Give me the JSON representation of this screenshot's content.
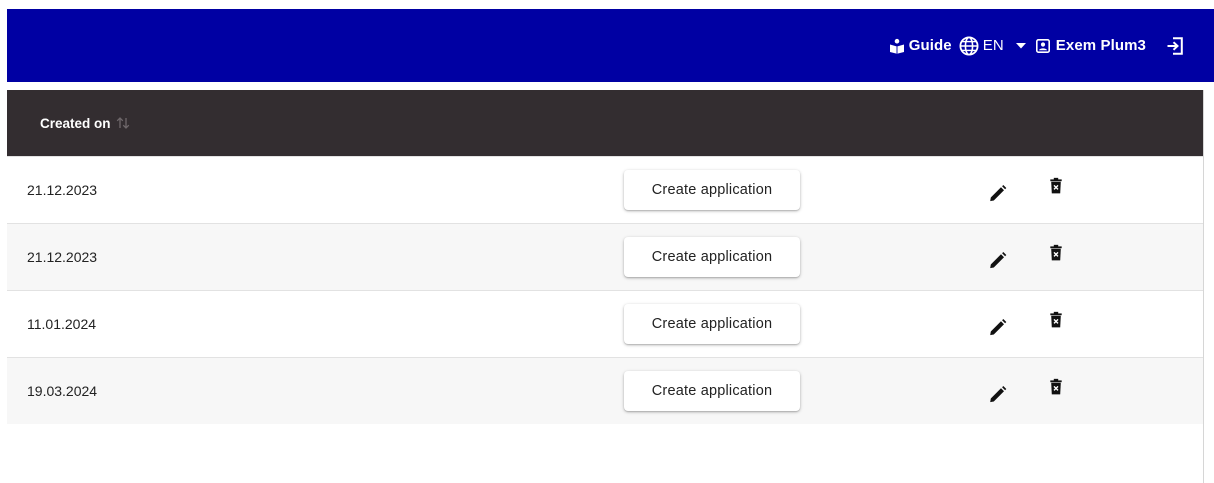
{
  "header": {
    "guide_label": "Guide",
    "language_label": "EN",
    "user_label": "Exem Plum3",
    "background_color": "#0000a3"
  },
  "table": {
    "header_background": "#332d30",
    "columns": [
      {
        "label": "Created on",
        "sort_icon": "sort-arrows-icon"
      }
    ],
    "rows": [
      {
        "created_on": "21.12.2023",
        "action_label": "Create application"
      },
      {
        "created_on": "21.12.2023",
        "action_label": "Create application"
      },
      {
        "created_on": "11.01.2024",
        "action_label": "Create application"
      },
      {
        "created_on": "19.03.2024",
        "action_label": "Create application"
      }
    ],
    "row_icons": [
      "pencil-icon",
      "trash-icon"
    ]
  }
}
